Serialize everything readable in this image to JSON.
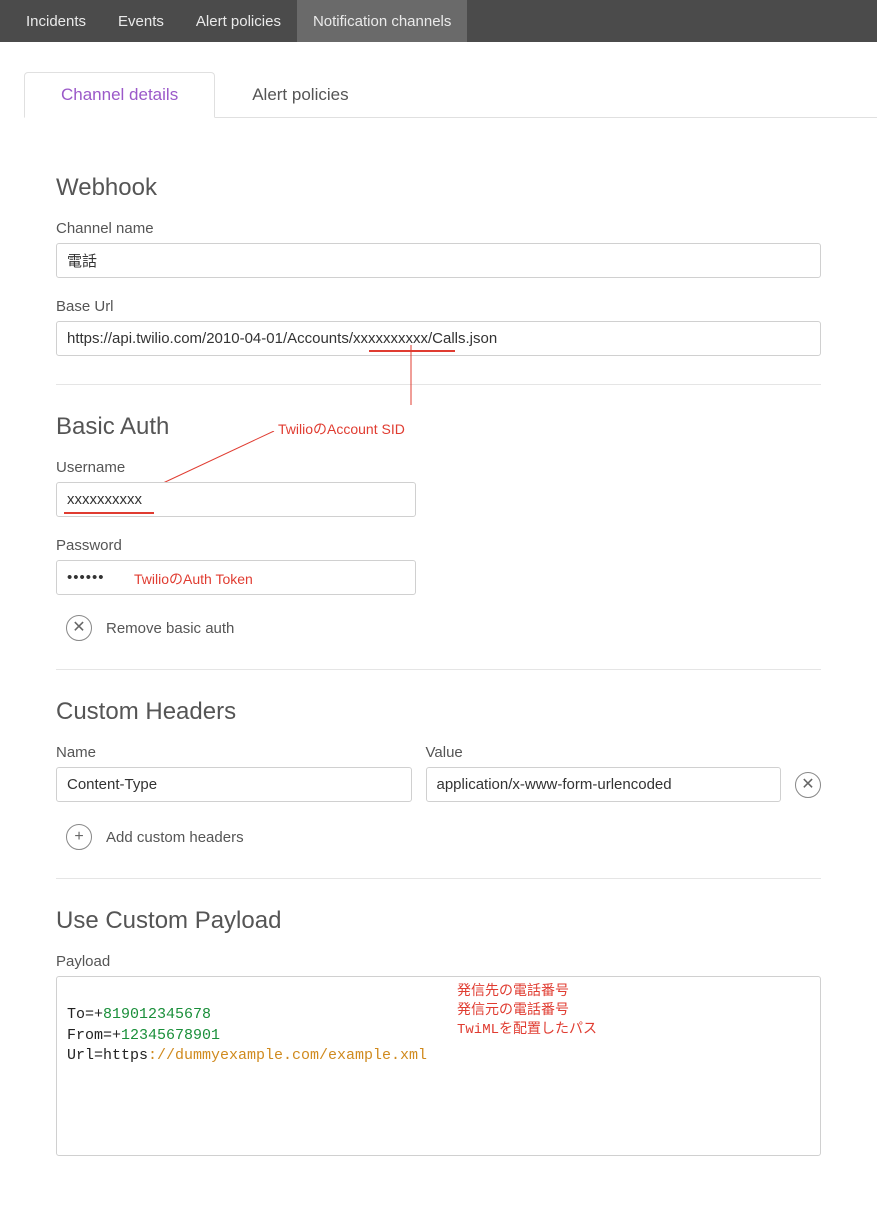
{
  "topnav": {
    "items": [
      "Incidents",
      "Events",
      "Alert policies",
      "Notification channels"
    ],
    "active": 3
  },
  "tabs": {
    "items": [
      "Channel details",
      "Alert policies"
    ],
    "active": 0
  },
  "webhook": {
    "title": "Webhook",
    "channel_name_label": "Channel name",
    "channel_name_value": "電話",
    "base_url_label": "Base Url",
    "base_url_prefix": "https://api.twilio.com/2010-04-01/Accounts/",
    "base_url_mid": "xxxxxxxxxx",
    "base_url_suffix": "/Calls.json"
  },
  "basic_auth": {
    "title": "Basic Auth",
    "username_label": "Username",
    "username_value": "xxxxxxxxxx",
    "password_label": "Password",
    "password_value": "••••••",
    "remove_label": "Remove basic auth"
  },
  "annotations": {
    "account_sid": "TwilioのAccount SID",
    "auth_token": "TwilioのAuth Token",
    "to_desc": "発信先の電話番号",
    "from_desc": "発信元の電話番号",
    "url_desc": "TwiMLを配置したパス"
  },
  "custom_headers": {
    "title": "Custom Headers",
    "name_label": "Name",
    "value_label": "Value",
    "name_value": "Content-Type",
    "value_value": "application/x-www-form-urlencoded",
    "add_label": "Add custom headers"
  },
  "payload": {
    "title": "Use Custom Payload",
    "label": "Payload",
    "to_key": "To=+",
    "to_val": "819012345678",
    "from_key": "From=+",
    "from_val": "12345678901",
    "url_key": "Url=https",
    "url_val": "://dummyexample.com/example.xml"
  }
}
